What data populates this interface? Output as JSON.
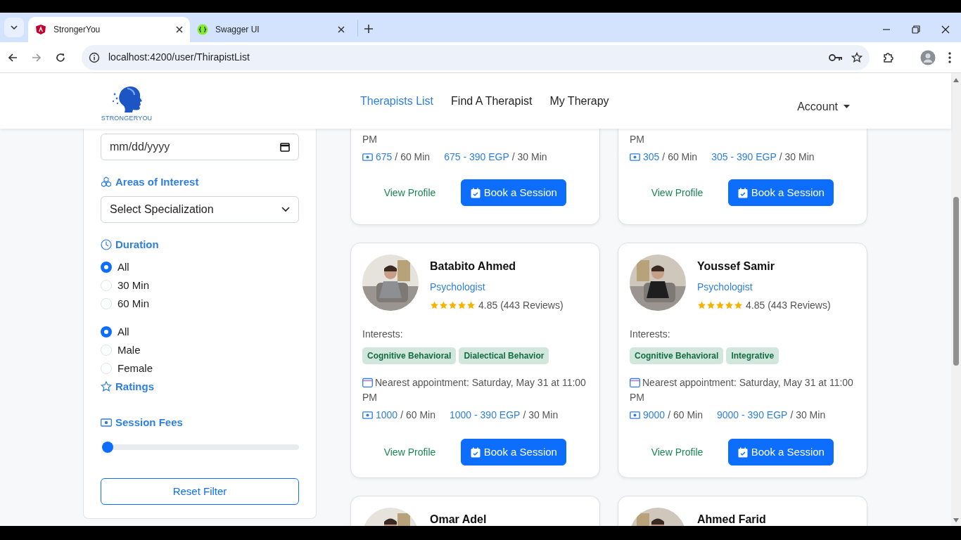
{
  "browser": {
    "tabs": [
      {
        "title": "StrongerYou",
        "selected": true
      },
      {
        "title": "Swagger UI",
        "selected": false
      }
    ],
    "url": "localhost:4200/user/ThirapistList"
  },
  "navbar": {
    "brand": "STRONGERYOU",
    "links": [
      {
        "label": "Therapists List",
        "selected": true
      },
      {
        "label": "Find A Therapist",
        "selected": false
      },
      {
        "label": "My Therapy",
        "selected": false
      }
    ],
    "account": "Account"
  },
  "filters": [
    {
      "kind": "date",
      "placeholder": "mm/dd/yyyy"
    },
    {
      "kind": "heading",
      "label": "Areas of Interest"
    },
    {
      "kind": "select",
      "value": "Select Specialization"
    },
    {
      "kind": "heading",
      "label": "Duration"
    },
    {
      "kind": "radios",
      "options": [
        {
          "label": "All",
          "selected": true
        },
        {
          "label": "30 Min",
          "selected": false
        },
        {
          "label": "60 Min",
          "selected": false
        }
      ]
    },
    {
      "kind": "radios",
      "options": [
        {
          "label": "All",
          "selected": true
        },
        {
          "label": "Male",
          "selected": false
        },
        {
          "label": "Female",
          "selected": false
        }
      ]
    },
    {
      "kind": "heading",
      "label": "Ratings"
    },
    {
      "kind": "heading",
      "label": "Session Fees"
    },
    {
      "kind": "slider",
      "level": 0
    },
    {
      "kind": "reset",
      "label": "Reset Filter"
    }
  ],
  "therapists": [
    {
      "kind": "partial-top",
      "appointment": "PM",
      "fee_60": "675",
      "fee_60_unit": "/ 60 Min",
      "fee_30": "675 - 390 EGP",
      "fee_30_unit": "/ 30 Min",
      "view": "View Profile",
      "book": "Book a Session"
    },
    {
      "kind": "partial-top",
      "appointment": "PM",
      "fee_60": "305",
      "fee_60_unit": "/ 60 Min",
      "fee_30": "305 - 390 EGP",
      "fee_30_unit": "/ 30 Min",
      "view": "View Profile",
      "book": "Book a Session"
    },
    {
      "kind": "full",
      "name": "Batabito Ahmed",
      "specialty": "Psychologist",
      "stars": 5,
      "rating": "4.85 (443 Reviews)",
      "interests_label": "Interests:",
      "interests": [
        "Cognitive Behavioral",
        "Dialectical Behavior"
      ],
      "appointment": "Nearest appointment: Saturday, May 31 at 11:00 PM",
      "fee_60": "1000",
      "fee_60_unit": "/ 60 Min",
      "fee_30": "1000 - 390 EGP",
      "fee_30_unit": "/ 30 Min",
      "view": "View Profile",
      "book": "Book a Session"
    },
    {
      "kind": "full",
      "name": "Youssef Samir",
      "specialty": "Psychologist",
      "stars": 5,
      "rating": "4.85 (443 Reviews)",
      "interests_label": "Interests:",
      "interests": [
        "Cognitive Behavioral",
        "Integrative"
      ],
      "appointment": "Nearest appointment: Saturday, May 31 at 11:00 PM",
      "fee_60": "9000",
      "fee_60_unit": "/ 60 Min",
      "fee_30": "9000 - 390 EGP",
      "fee_30_unit": "/ 30 Min",
      "view": "View Profile",
      "book": "Book a Session"
    },
    {
      "kind": "partial-bottom",
      "name": "Omar Adel"
    },
    {
      "kind": "partial-bottom",
      "name": "Ahmed Farid"
    }
  ]
}
